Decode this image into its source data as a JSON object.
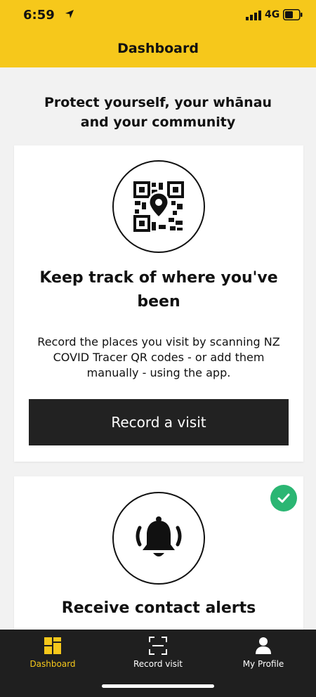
{
  "status_bar": {
    "time": "6:59",
    "network": "4G",
    "icons": [
      "location-arrow-icon",
      "signal-icon",
      "battery-icon"
    ]
  },
  "header": {
    "title": "Dashboard",
    "background": "#f6c81b"
  },
  "tagline": "Protect yourself, your whānau and your community",
  "cards": [
    {
      "icon": "qr-location-icon",
      "heading": "Keep track of where you've been",
      "description": "Record the places you visit by scanning NZ COVID Tracer QR codes - or add them manually - using the app.",
      "button_label": "Record a visit"
    },
    {
      "icon": "bell-icon",
      "heading": "Receive contact alerts",
      "badge_icon": "check-icon",
      "badge_color": "#2bb673"
    }
  ],
  "tabbar": {
    "items": [
      {
        "label": "Dashboard",
        "icon": "dashboard-icon",
        "active": true
      },
      {
        "label": "Record visit",
        "icon": "scan-icon",
        "active": false
      },
      {
        "label": "My Profile",
        "icon": "profile-icon",
        "active": false
      }
    ],
    "active_color": "#f6c81b"
  }
}
